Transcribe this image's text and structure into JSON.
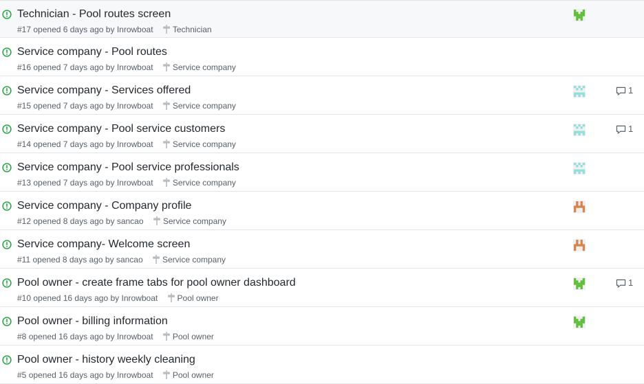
{
  "issues": [
    {
      "title": "Technician - Pool routes screen",
      "number": "#17",
      "opened": "opened 6 days ago by",
      "author": "Inrowboat",
      "milestone": "Technician",
      "avatar": "green",
      "comments": "",
      "highlight": true
    },
    {
      "title": "Service company - Pool routes",
      "number": "#16",
      "opened": "opened 7 days ago by",
      "author": "Inrowboat",
      "milestone": "Service company",
      "avatar": "",
      "comments": "",
      "highlight": false
    },
    {
      "title": "Service company - Services offered",
      "number": "#15",
      "opened": "opened 7 days ago by",
      "author": "Inrowboat",
      "milestone": "Service company",
      "avatar": "teal",
      "comments": "1",
      "highlight": false
    },
    {
      "title": "Service company - Pool service customers",
      "number": "#14",
      "opened": "opened 7 days ago by",
      "author": "Inrowboat",
      "milestone": "Service company",
      "avatar": "teal",
      "comments": "1",
      "highlight": false
    },
    {
      "title": "Service company - Pool service professionals",
      "number": "#13",
      "opened": "opened 7 days ago by",
      "author": "Inrowboat",
      "milestone": "Service company",
      "avatar": "teal",
      "comments": "",
      "highlight": false
    },
    {
      "title": "Service company - Company profile",
      "number": "#12",
      "opened": "opened 8 days ago by",
      "author": "sancao",
      "milestone": "Service company",
      "avatar": "orange",
      "comments": "",
      "highlight": false
    },
    {
      "title": "Service company- Welcome screen",
      "number": "#11",
      "opened": "opened 8 days ago by",
      "author": "sancao",
      "milestone": "Service company",
      "avatar": "orange",
      "comments": "",
      "highlight": false
    },
    {
      "title": "Pool owner - create frame tabs for pool owner dashboard",
      "number": "#10",
      "opened": "opened 16 days ago by",
      "author": "Inrowboat",
      "milestone": "Pool owner",
      "avatar": "green",
      "comments": "1",
      "highlight": false
    },
    {
      "title": "Pool owner - billing information",
      "number": "#8",
      "opened": "opened 16 days ago by",
      "author": "Inrowboat",
      "milestone": "Pool owner",
      "avatar": "green",
      "comments": "",
      "highlight": false
    },
    {
      "title": "Pool owner - history weekly cleaning",
      "number": "#5",
      "opened": "opened 16 days ago by",
      "author": "Inrowboat",
      "milestone": "Pool owner",
      "avatar": "",
      "comments": "",
      "highlight": false
    }
  ],
  "colors": {
    "open_icon": "#28a745",
    "avatar_green": "#5fbf3a",
    "avatar_teal": "#8fdedd",
    "avatar_orange": "#d9824a"
  },
  "icons": {
    "open": "issue-opened-icon",
    "milestone": "milestone-icon",
    "comment": "comment-icon",
    "avatar": "identicon-avatar"
  }
}
